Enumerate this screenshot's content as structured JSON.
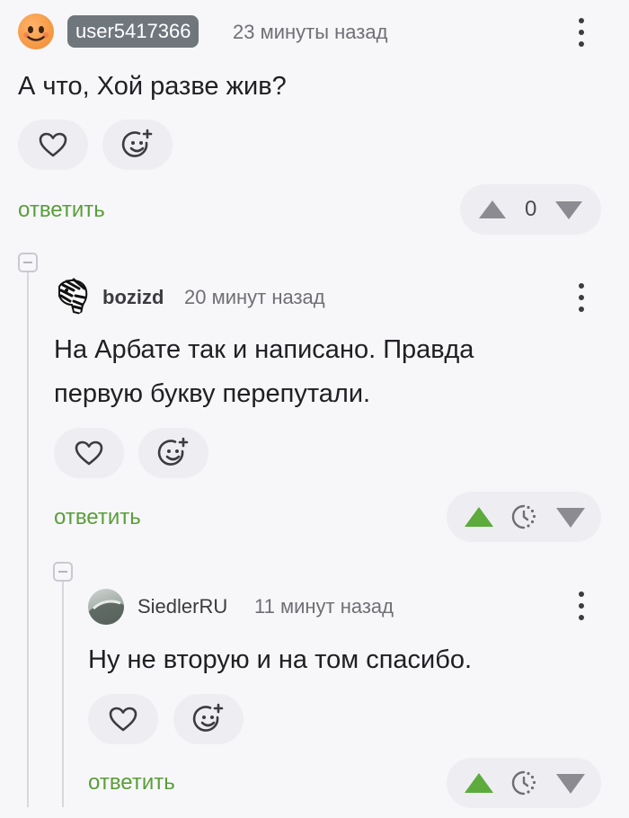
{
  "comments": [
    {
      "username": "user5417366",
      "timestamp": "23 минуты назад",
      "text": "А что, Хой разве жив?",
      "reply_label": "ответить",
      "rating": "0"
    },
    {
      "username": "bozizd",
      "timestamp": "20 минут назад",
      "text_lines": [
        "На Арбате так и написано. Правда",
        "первую букву перепутали."
      ],
      "reply_label": "ответить"
    },
    {
      "username": "SiedlerRU",
      "timestamp": "11 минут назад",
      "text": "Ну не вторую и на том спасибо.",
      "reply_label": "ответить"
    }
  ],
  "colors": {
    "accent_green": "#5a9e3a",
    "upvote_active": "#5cab3c",
    "badge_gray": "#6f777d",
    "icon_gray": "#8b8b91"
  },
  "icons": {
    "like": "heart-icon",
    "react": "emoji-add-icon",
    "menu": "more-vertical-icon",
    "upvote": "triangle-up-icon",
    "downvote": "triangle-down-icon",
    "pending": "clock-pending-icon",
    "collapse": "collapse-minus-icon"
  }
}
